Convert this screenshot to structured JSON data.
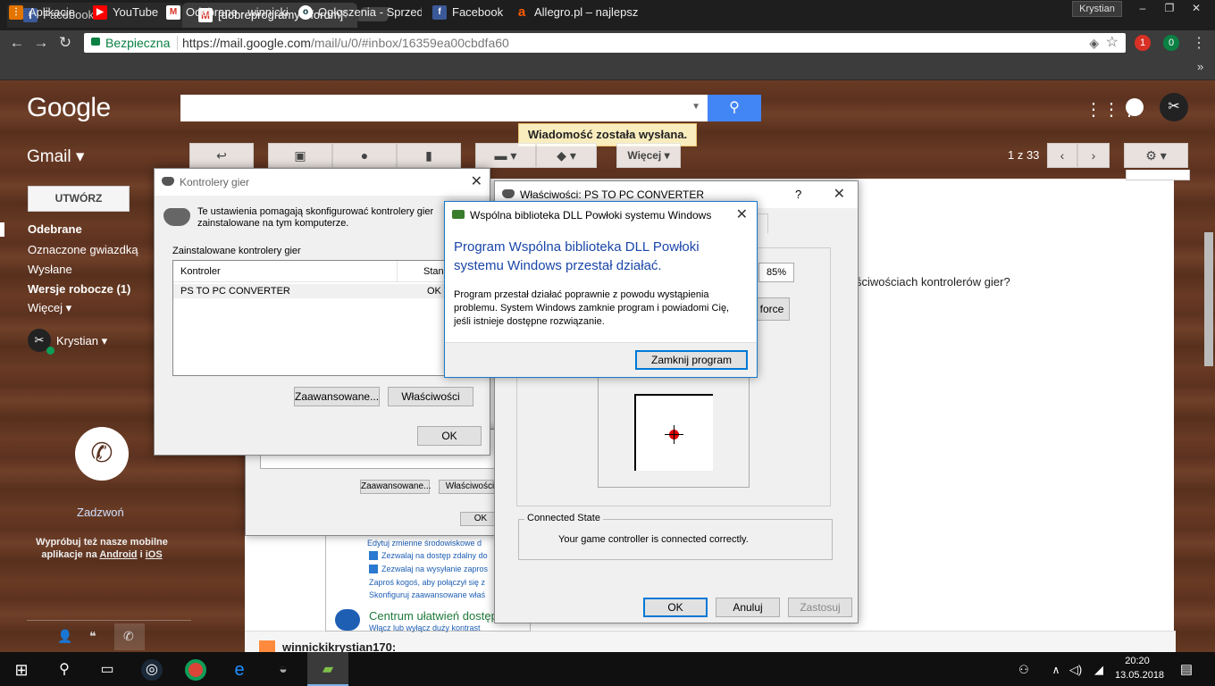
{
  "browser": {
    "tabs": [
      {
        "title": "Facebook",
        "icon": "facebook-icon",
        "color": "#3b5998"
      },
      {
        "title": "[dobreprogramy - forum]",
        "icon": "gmail-icon",
        "color": "#d93025"
      }
    ],
    "profile": "Krystian",
    "window_controls": [
      "–",
      "❐",
      "✕"
    ],
    "secure_label": "Bezpieczna",
    "url_host": "https://mail.google.com",
    "url_path": "/mail/u/0/#inbox/16359ea00cbdfa60",
    "extensions": [
      {
        "badge": "1",
        "color": "#d93025"
      },
      {
        "badge": "0",
        "color": "#0b8043"
      }
    ],
    "bookmarks": [
      {
        "label": "Aplikacje",
        "icon": "apps-icon",
        "color": "#e37400"
      },
      {
        "label": "YouTube",
        "icon": "youtube-icon",
        "color": "#ff0000"
      },
      {
        "label": "Odebrane - winnicki",
        "icon": "gmail-icon",
        "color": "#d93025"
      },
      {
        "label": "Ogłoszenia - Sprzed",
        "icon": "olx-icon",
        "color": "#002f34"
      },
      {
        "label": "Facebook",
        "icon": "facebook-icon",
        "color": "#3b5998"
      },
      {
        "label": "Allegro.pl – najlepsz",
        "icon": "allegro-icon",
        "color": "#ff5a00"
      }
    ],
    "bookmarks_more": "»"
  },
  "gmail": {
    "logo": "Google",
    "app_label": "Gmail ▾",
    "toast": "Wiadomość została wysłana.",
    "more_button": "Więcej ▾",
    "pager": "1 z 33",
    "compose": "UTWÓRZ",
    "nav": [
      "Odebrane",
      "Oznaczone gwiazdką",
      "Wysłane",
      "Wersje robocze (1)",
      "Więcej ▾"
    ],
    "user": "Krystian ▾",
    "call": "Zadzwoń",
    "promo_text": "Wypróbuj też nasze mobilne aplikacje na",
    "promo_android": "Android",
    "promo_and": "i",
    "promo_ios": "iOS",
    "body_fragment": "ściwościach kontrolerów gier?",
    "sender_fragment": "winnickikrystian170:"
  },
  "control_panel": {
    "items": [
      "Edytuj zmienne środowiskowe d",
      "Zezwalaj na dostęp zdalny do",
      "Zezwalaj na wysyłanie zapros",
      "Zaproś kogoś, aby połączył się z",
      "Skonfiguruj zaawansowane właś"
    ],
    "section": "Centrum ułatwień dostęp",
    "section_sub": "Włącz lub wyłącz duży kontrast"
  },
  "behind_dialog": {
    "btn_advanced": "Zaawansowane...",
    "btn_props": "Właściwości",
    "btn_ok": "OK"
  },
  "game_controllers": {
    "title": "Kontrolery gier",
    "description": "Te ustawienia pomagają skonfigurować kontrolery gier zainstalowane na tym komputerze.",
    "group_label": "Zainstalowane kontrolery gier",
    "columns": [
      "Kontroler",
      "Stan"
    ],
    "rows": [
      {
        "name": "PS TO PC CONVERTER",
        "status": "OK"
      }
    ],
    "btn_advanced": "Zaawansowane...",
    "btn_props": "Właściwości",
    "btn_ok": "OK"
  },
  "properties": {
    "title": "Właściwości: PS TO PC CONVERTER",
    "help": "?",
    "tab_fragment": "ut",
    "percent": "85%",
    "force_btn": "force",
    "connected_group": "Connected State",
    "connected_text": "Your game controller is connected correctly.",
    "btn_ok": "OK",
    "btn_cancel": "Anuluj",
    "btn_apply": "Zastosuj"
  },
  "error_dialog": {
    "title": "Wspólna biblioteka DLL Powłoki systemu Windows",
    "heading": "Program Wspólna biblioteka DLL Powłoki systemu Windows przestał działać.",
    "message": "Program przestał działać poprawnie z powodu wystąpienia problemu. System Windows zamknie program i powiadomi Cię, jeśli istnieje dostępne rozwiązanie.",
    "btn_close": "Zamknij program"
  },
  "taskbar": {
    "time": "20:20",
    "date": "13.05.2018"
  }
}
